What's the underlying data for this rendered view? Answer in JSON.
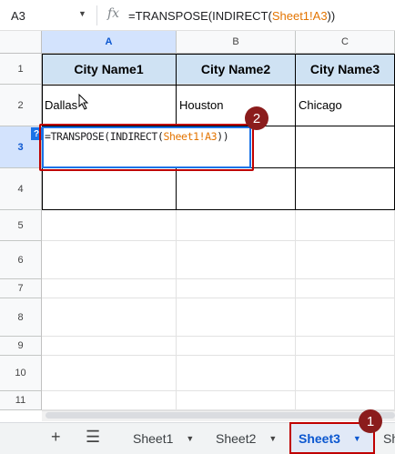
{
  "name_box": {
    "value": "A3"
  },
  "formula_bar": {
    "fx": "fx",
    "formula_prefix": "=TRANSPOSE(INDIRECT(",
    "formula_ref": "Sheet1!A3",
    "formula_suffix": "))"
  },
  "columns": [
    {
      "label": "A",
      "active": true
    },
    {
      "label": "B",
      "active": false
    },
    {
      "label": "C",
      "active": false
    }
  ],
  "rows": [
    "1",
    "2",
    "3",
    "4",
    "5",
    "6",
    "7",
    "8",
    "9",
    "10",
    "11"
  ],
  "active_row": "3",
  "cells": {
    "a1": "City Name1",
    "b1": "City Name2",
    "c1": "City Name3",
    "a2": "Dallas",
    "b2": "Houston",
    "c2": "Chicago"
  },
  "editor": {
    "prefix": "=TRANSPOSE(INDIRECT(",
    "ref": "Sheet1!A3",
    "suffix": "))",
    "hint": "?"
  },
  "badges": {
    "one": "1",
    "two": "2"
  },
  "sheet_tabs": [
    {
      "label": "Sheet1",
      "active": false
    },
    {
      "label": "Sheet2",
      "active": false
    },
    {
      "label": "Sheet3",
      "active": true
    },
    {
      "label": "Sh",
      "active": false
    }
  ],
  "colors": {
    "header_fill": "#cfe2f3",
    "accent": "#0b57d0",
    "annotation": "#c00000",
    "ref": "#e37400"
  }
}
